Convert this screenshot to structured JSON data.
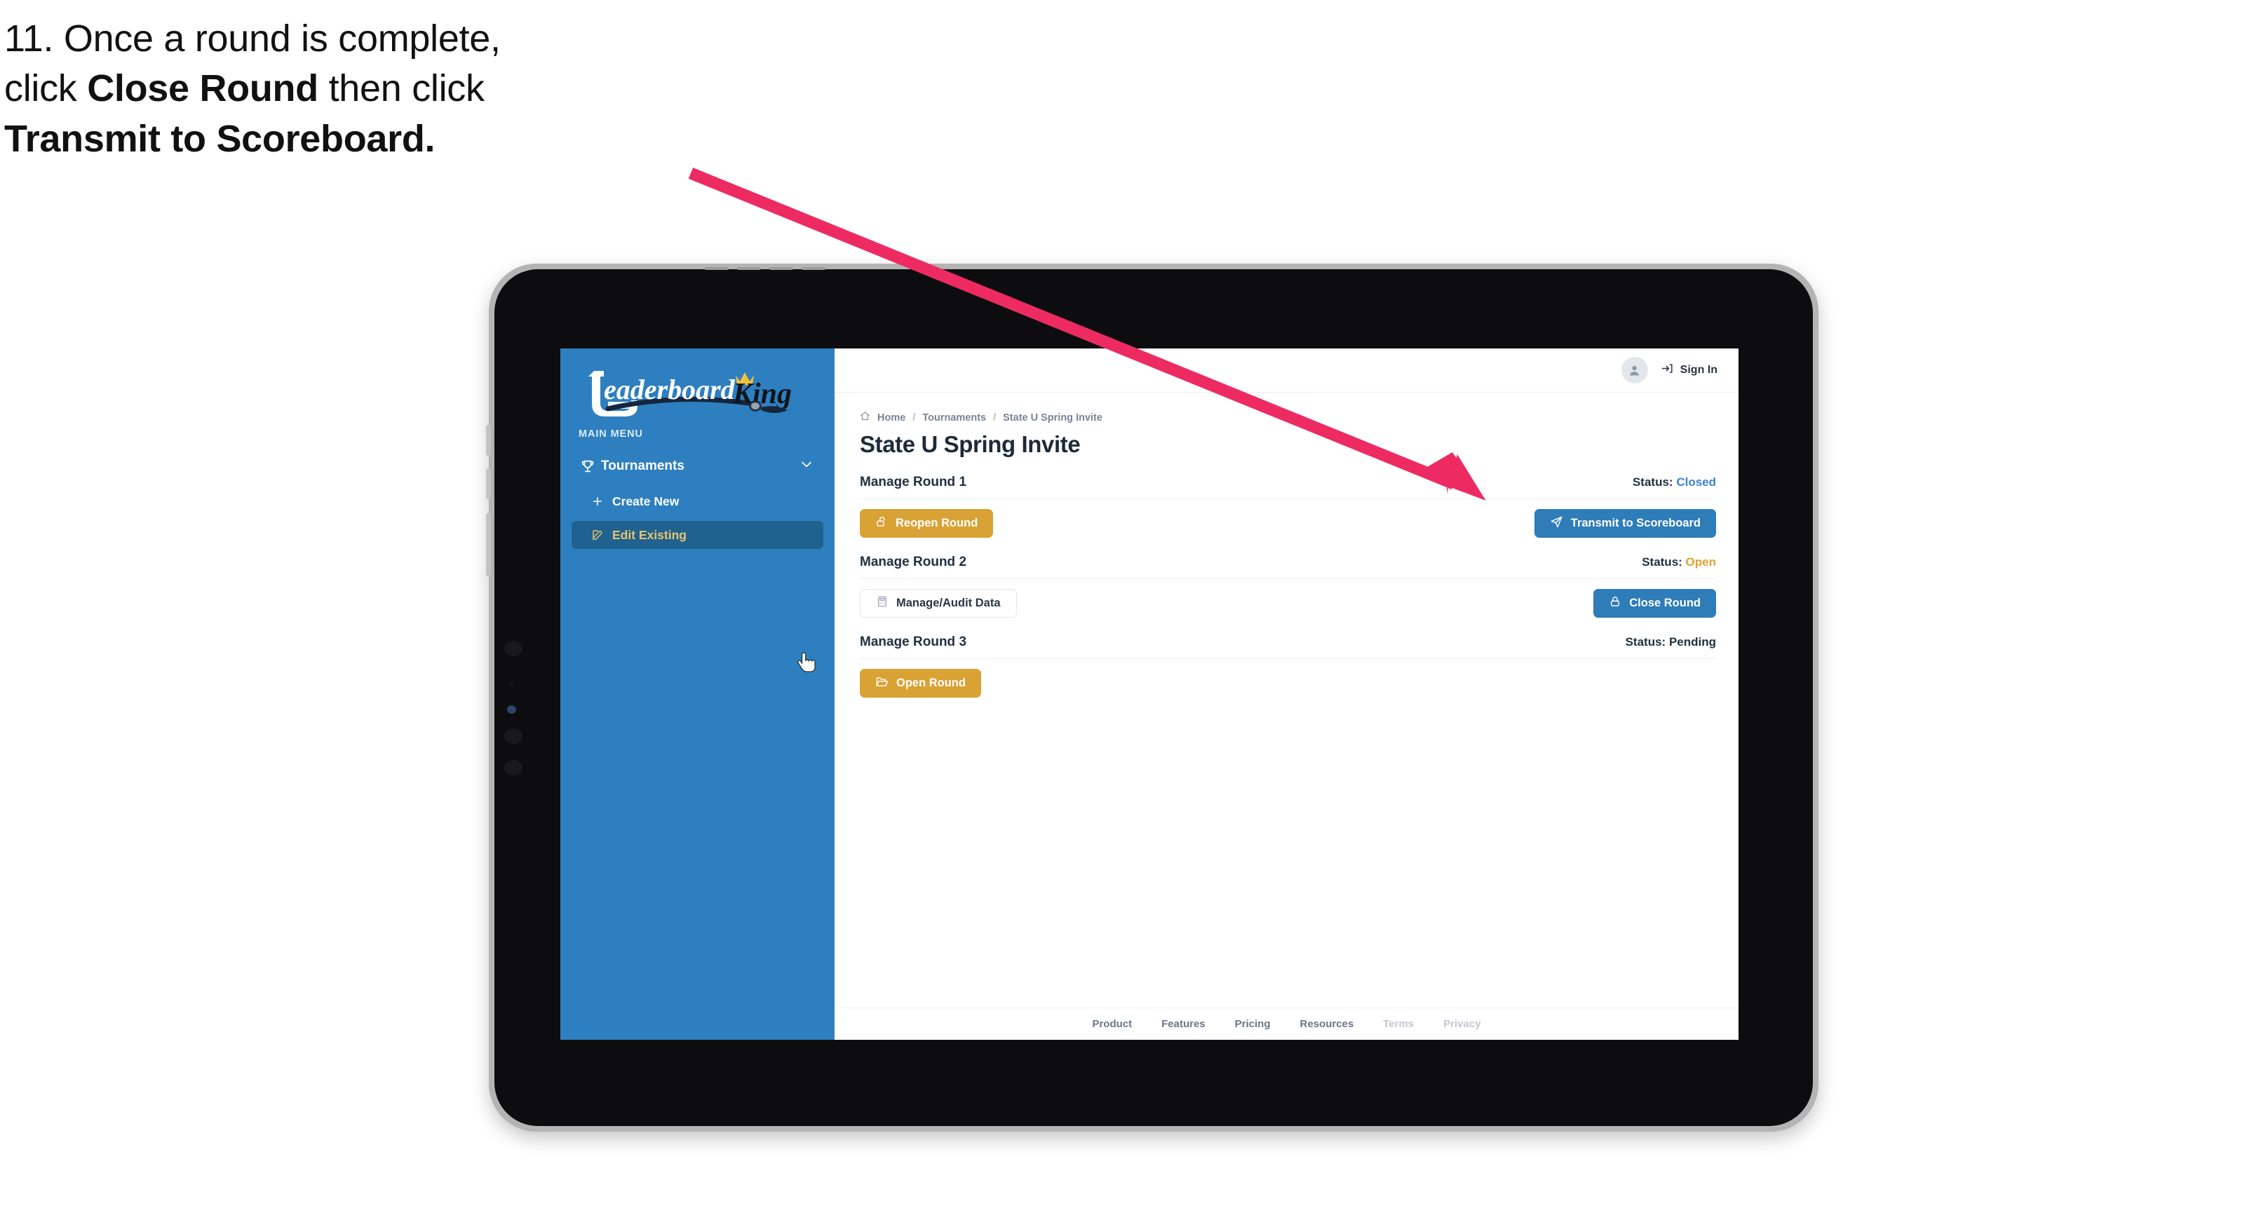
{
  "caption": {
    "line1_plain": "11. Once a round is complete,",
    "line2_pre": "click ",
    "line2_bold": "Close Round",
    "line2_post": " then click",
    "line3_bold": "Transmit to Scoreboard."
  },
  "annotation": {
    "arrow_color": "#ED2B62",
    "points_to": "Transmit to Scoreboard"
  },
  "app": {
    "logo_text_primary": "Leaderboard",
    "logo_text_secondary": "King"
  },
  "sidebar": {
    "section_label": "MAIN MENU",
    "nav": {
      "label": "Tournaments",
      "icon": "trophy-icon",
      "chevron": "chevron-down-icon"
    },
    "sub_items": [
      {
        "label": "Create New",
        "icon": "plus-icon",
        "active": false
      },
      {
        "label": "Edit Existing",
        "icon": "edit-pencil-icon",
        "active": true
      }
    ],
    "accent_bg": "#2e7fbf",
    "active_bg": "#1f618f",
    "active_text": "#e9c46a"
  },
  "topbar": {
    "avatar_icon": "user-avatar-icon",
    "signin_icon": "login-arrow-icon",
    "signin_label": "Sign In"
  },
  "breadcrumb": {
    "home_icon": "home-icon",
    "items": [
      "Home",
      "Tournaments",
      "State U Spring Invite"
    ],
    "separator": "/"
  },
  "page": {
    "title": "State U Spring Invite"
  },
  "rounds": [
    {
      "name": "Manage Round 1",
      "status_label": "Status:",
      "status_value": "Closed",
      "status_kind": "closed",
      "left_button": {
        "label": "Reopen Round",
        "icon": "unlock-icon",
        "style": "gold"
      },
      "right_button": {
        "label": "Transmit to Scoreboard",
        "icon": "paper-plane-icon",
        "style": "blue"
      }
    },
    {
      "name": "Manage Round 2",
      "status_label": "Status:",
      "status_value": "Open",
      "status_kind": "open",
      "left_button": {
        "label": "Manage/Audit Data",
        "icon": "calculator-icon",
        "style": "ghost"
      },
      "right_button": {
        "label": "Close Round",
        "icon": "lock-icon",
        "style": "blue"
      }
    },
    {
      "name": "Manage Round 3",
      "status_label": "Status:",
      "status_value": "Pending",
      "status_kind": "pending",
      "left_button": {
        "label": "Open Round",
        "icon": "open-folder-icon",
        "style": "gold"
      },
      "right_button": null
    }
  ],
  "footer": {
    "links": [
      {
        "label": "Product",
        "dim": false
      },
      {
        "label": "Features",
        "dim": false
      },
      {
        "label": "Pricing",
        "dim": false
      },
      {
        "label": "Resources",
        "dim": false
      },
      {
        "label": "Terms",
        "dim": true
      },
      {
        "label": "Privacy",
        "dim": true
      }
    ]
  },
  "colors": {
    "gold": "#d9a235",
    "blue": "#2e7cb8",
    "sidebar_blue": "#2e7fbf",
    "status_open": "#e0a32e",
    "status_closed": "#3b82d6",
    "arrow_pink": "#ED2B62"
  }
}
